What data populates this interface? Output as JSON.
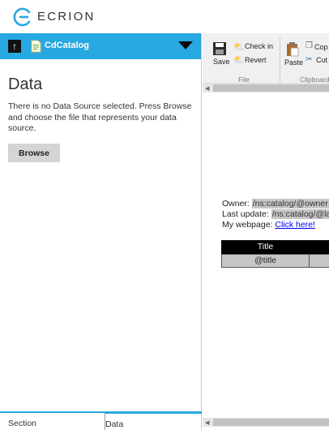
{
  "brand": {
    "name": "ECRION",
    "accent": "#27a8e0"
  },
  "doc_bar": {
    "up_icon": "up-arrow-icon",
    "doc_name": "CdCatalog",
    "collapse_icon": "triangle-down-icon"
  },
  "data_source": {
    "title": "Data",
    "message": "There is no Data Source selected. Press Browse and choose the file that represents your data source.",
    "browse_label": "Browse"
  },
  "bottom_tabs": {
    "section": "Section",
    "data": "Data"
  },
  "ribbon": {
    "save": "Save",
    "check_in": "Check in",
    "revert": "Revert",
    "paste": "Paste",
    "copy": "Cop",
    "cut": "Cut",
    "group_file": "File",
    "group_clipboard": "Clipboard"
  },
  "template": {
    "owner_label": "Owner: ",
    "owner_field": "/ns:catalog/@owner",
    "last_update_label": "Last update: ",
    "last_update_field": "/ns:catalog/@la",
    "webpage_label": "My webpage: ",
    "webpage_link": "Click here!",
    "table_header": "Title",
    "table_cell": "@title"
  }
}
